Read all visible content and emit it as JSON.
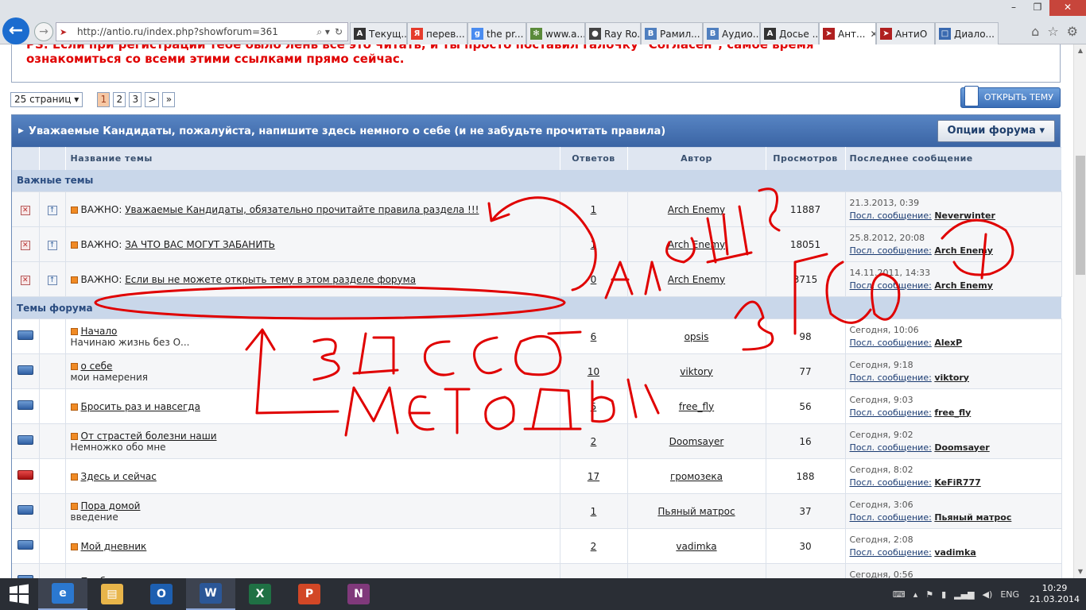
{
  "browser": {
    "url": "http://antio.ru/index.php?showforum=361",
    "tabs": [
      {
        "label": "Текущ...",
        "icon": "A",
        "color": "#333333"
      },
      {
        "label": "перев...",
        "icon": "Я",
        "color": "#e53b2c"
      },
      {
        "label": "the pr...",
        "icon": "g",
        "color": "#4a8cf0"
      },
      {
        "label": "www.a...",
        "icon": "✻",
        "color": "#5a8a3a"
      },
      {
        "label": "Ray Ro...",
        "icon": "●",
        "color": "#444444"
      },
      {
        "label": "Рамил...",
        "icon": "B",
        "color": "#4f7fbf"
      },
      {
        "label": "Аудио...",
        "icon": "B",
        "color": "#4f7fbf"
      },
      {
        "label": "Досье ...",
        "icon": "A",
        "color": "#333333"
      },
      {
        "label": "Ант...",
        "icon": "➤",
        "color": "#b02020"
      },
      {
        "label": "АнтиО",
        "icon": "➤",
        "color": "#b02020"
      },
      {
        "label": "Диало...",
        "icon": "□",
        "color": "#3a6ab0"
      }
    ]
  },
  "notice": {
    "line1": "PS: Если при регистрации тебе было лень все это читать, и ты просто поставил галочку \"Согласен\", самое время",
    "line2": "ознакомиться со всеми этими ссылками прямо сейчас."
  },
  "pager": {
    "pages_label": "25 страниц",
    "pages": [
      "1",
      "2",
      "3"
    ],
    "next": ">",
    "last": "»"
  },
  "new_topic_label": "ОТКРЫТЬ ТЕМУ",
  "forum": {
    "title": "Уважаемые Кандидаты, пожалуйста, напишите здесь немного о себе (и не забудьте прочитать правила)",
    "options_label": "Опции форума ▾",
    "columns": {
      "topic": "Название темы",
      "replies": "Ответов",
      "author": "Автор",
      "views": "Просмотров",
      "last": "Последнее сообщение"
    },
    "pinned_label": "Важные темы",
    "topics_label": "Темы форума",
    "last_prefix": "Посл. сообщение:",
    "important_prefix": "ВАЖНО:",
    "pinned": [
      {
        "title": "Уважаемые Кандидаты, обязательно прочитайте правила раздела !!!",
        "replies": "1",
        "author": "Arch Enemy",
        "views": "11887",
        "date": "21.3.2013, 0:39",
        "last_user": "Neverwinter"
      },
      {
        "title": "ЗА ЧТО ВАС МОГУТ ЗАБАНИТЬ",
        "replies": "1",
        "author": "Arch Enemy",
        "views": "18051",
        "date": "25.8.2012, 20:08",
        "last_user": "Arch Enemy"
      },
      {
        "title": "Если вы не можете открыть тему в этом разделе форума",
        "replies": "0",
        "author": "Arch Enemy",
        "views": "3715",
        "date": "14.11.2011, 14:33",
        "last_user": "Arch Enemy"
      }
    ],
    "topics": [
      {
        "title": "Начало",
        "desc": "Начинаю жизнь без О...",
        "replies": "6",
        "author": "opsis",
        "views": "98",
        "date": "Сегодня, 10:06",
        "last_user": "AlexP",
        "hot": false
      },
      {
        "title": "о себе",
        "desc": "мои намерения",
        "replies": "10",
        "author": "viktory",
        "views": "77",
        "date": "Сегодня, 9:18",
        "last_user": "viktory",
        "hot": false
      },
      {
        "title": "Бросить раз и навсегда",
        "desc": "",
        "replies": "5",
        "author": "free_fly",
        "views": "56",
        "date": "Сегодня, 9:03",
        "last_user": "free_fly",
        "hot": false
      },
      {
        "title": "От страстей болезни наши",
        "desc": "Немножко обо мне",
        "replies": "2",
        "author": "Doomsayer",
        "views": "16",
        "date": "Сегодня, 9:02",
        "last_user": "Doomsayer",
        "hot": false
      },
      {
        "title": "Здесь и сейчас",
        "desc": "",
        "replies": "17",
        "author": "громозека",
        "views": "188",
        "date": "Сегодня, 8:02",
        "last_user": "KeFiR777",
        "hot": true
      },
      {
        "title": "Пора домой",
        "desc": "введение",
        "replies": "1",
        "author": "Пьяный матрос",
        "views": "37",
        "date": "Сегодня, 3:06",
        "last_user": "Пьяный матрос",
        "hot": false
      },
      {
        "title": "Мой дневник",
        "desc": "",
        "replies": "2",
        "author": "vadimka",
        "views": "30",
        "date": "Сегодня, 2:08",
        "last_user": "vadimka",
        "hot": false
      },
      {
        "title": "Проблема в мыслях",
        "desc": "",
        "replies": "",
        "author": "",
        "views": "",
        "date": "Сегодня, 0:56",
        "last_user": "",
        "hot": false
      }
    ]
  },
  "taskbar": {
    "apps": [
      {
        "name": "ie",
        "label": "e",
        "color": "#2b78d0"
      },
      {
        "name": "explorer",
        "label": "▤",
        "color": "#e8b54a"
      },
      {
        "name": "outlook",
        "label": "O",
        "color": "#1d5fb0"
      },
      {
        "name": "word",
        "label": "W",
        "color": "#2b5797"
      },
      {
        "name": "excel",
        "label": "X",
        "color": "#1f7144"
      },
      {
        "name": "powerpoint",
        "label": "P",
        "color": "#d24726"
      },
      {
        "name": "onenote",
        "label": "N",
        "color": "#80397b"
      }
    ],
    "lang": "ENG",
    "time": "10:29",
    "date": "21.03.2014"
  }
}
